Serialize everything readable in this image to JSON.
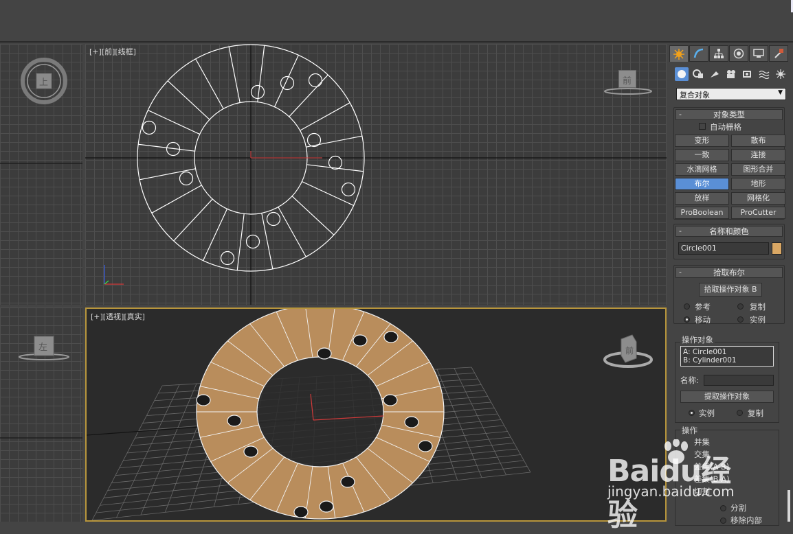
{
  "viewports": {
    "front": {
      "label": "[+][前][线框]",
      "cube_label": "前"
    },
    "top": {
      "cube_label": "上"
    },
    "left": {
      "cube_label": "左"
    },
    "perspective": {
      "label": "[+][透视][真实]",
      "cube_label": "前"
    }
  },
  "command_panel": {
    "tabs": [
      "create-icon",
      "modify-icon",
      "hierarchy-icon",
      "motion-icon",
      "display-icon",
      "utilities-icon"
    ],
    "subcategory_icons": [
      "geometry-icon",
      "shapes-icon",
      "lights-icon",
      "cameras-icon",
      "helpers-icon",
      "spacewarps-icon",
      "systems-icon"
    ],
    "category_dropdown": "复合对象",
    "object_type": {
      "title": "对象类型",
      "autogrid_label": "自动栅格",
      "buttons": [
        "变形",
        "散布",
        "一致",
        "连接",
        "水滴网格",
        "图形合并",
        "布尔",
        "地形",
        "放样",
        "网格化",
        "ProBoolean",
        "ProCutter"
      ],
      "selected": "布尔"
    },
    "name_color": {
      "title": "名称和颜色",
      "name_value": "Circle001",
      "color": "#d9a764"
    },
    "pick_boolean": {
      "title": "拾取布尔",
      "pick_button": "拾取操作对象 B",
      "options": [
        "参考",
        "复制",
        "移动",
        "实例"
      ],
      "selected": "移动"
    },
    "operands": {
      "group_title": "操作对象",
      "list": [
        "A: Circle001",
        "B: Cylinder001"
      ],
      "name_label": "名称:",
      "name_value": "",
      "extract_button": "提取操作对象",
      "options": [
        "实例",
        "复制"
      ],
      "selected": "实例"
    },
    "operation": {
      "group_title": "操作",
      "items": [
        "并集",
        "交集",
        "差集(A-B)",
        "差集(B-A)",
        "切割"
      ],
      "cut_options": [
        "分割",
        "移除内部"
      ]
    }
  },
  "watermark": {
    "main": "Baidu经验",
    "sub": "jingyan.baidu.com"
  }
}
